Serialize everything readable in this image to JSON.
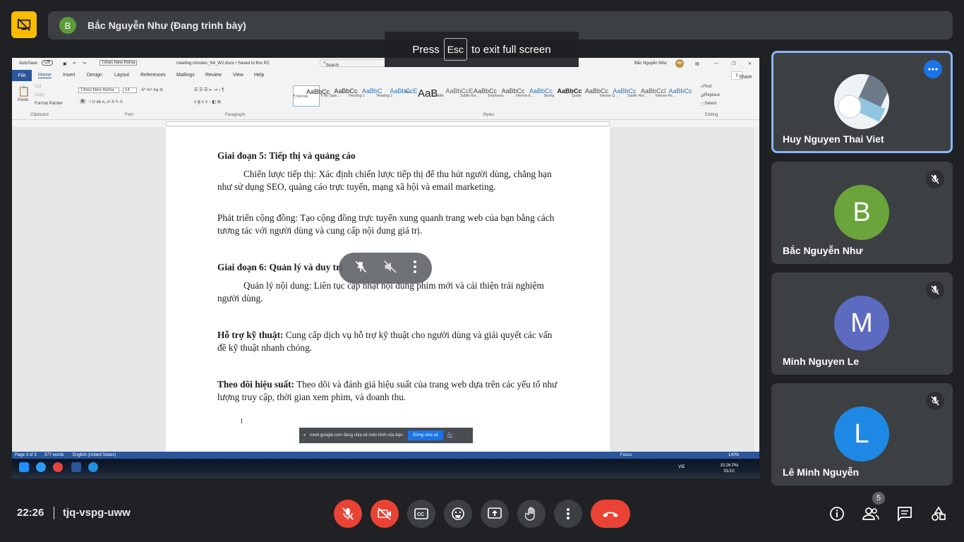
{
  "presenter": {
    "initial": "B",
    "label": "Bắc Nguyễn Như (Đang trình bày)"
  },
  "fullscreen_toast": {
    "press": "Press",
    "key": "Esc",
    "rest": "to exit full screen"
  },
  "word": {
    "autosave": "AutoSave",
    "autosave_state": "Off",
    "title": "meeting minutes_N4_W2.docx • Saved to this PC",
    "search": "Search",
    "user": "Bắc Nguyễn Như",
    "user_initials": "BN",
    "tabs": [
      "File",
      "Home",
      "Insert",
      "Design",
      "Layout",
      "References",
      "Mailings",
      "Review",
      "View",
      "Help"
    ],
    "share": "Share",
    "clipboard": {
      "paste": "Paste",
      "cut": "Cut",
      "copy": "Copy",
      "format_painter": "Format Painter",
      "group": "Clipboard"
    },
    "font": {
      "name": "Times New Roma",
      "size": "14",
      "group": "Font"
    },
    "paragraph_group": "Paragraph",
    "styles_group": "Styles",
    "editing": {
      "find": "Find",
      "replace": "Replace",
      "select": "Select",
      "group": "Editing"
    },
    "styles": [
      {
        "sample": "AaBbCc",
        "name": "¶ Normal"
      },
      {
        "sample": "AaBbCc",
        "name": "¶ No Spac..."
      },
      {
        "sample": "AaBbC",
        "name": "Heading 1"
      },
      {
        "sample": "AaBbCcE",
        "name": "Heading 2"
      },
      {
        "sample": "AaB",
        "name": "Title"
      },
      {
        "sample": "AaBbCcE",
        "name": "Subtitle"
      },
      {
        "sample": "AaBbCc",
        "name": "Subtle Em..."
      },
      {
        "sample": "AaBbCc",
        "name": "Emphasis"
      },
      {
        "sample": "AaBbCc",
        "name": "Intense E..."
      },
      {
        "sample": "AaBbCc",
        "name": "Strong"
      },
      {
        "sample": "AaBbCc",
        "name": "Quote"
      },
      {
        "sample": "AaBbCc",
        "name": "Intense Q..."
      },
      {
        "sample": "AaBbCcI",
        "name": "Subtle Ref..."
      },
      {
        "sample": "AaBbCc",
        "name": "Intense Re..."
      }
    ],
    "document": {
      "h5": "Giai đoạn 5: Tiếp thị và quảng cáo",
      "p1": "Chiến lược tiếp thị: Xác định chiến lược tiếp thị để thu hút người dùng, chẳng hạn như sử dụng SEO, quảng cáo trực tuyến, mạng xã hội và email marketing.",
      "p2": "Phát triển cộng đồng: Tạo cộng đồng trực tuyến xung quanh trang web của bạn bằng cách tương tác với người dùng và cung cấp nội dung giá trị.",
      "h6": "Giai đoạn 6: Quản lý và duy trì",
      "p3": "Quản lý nội dung: Liên tục cập nhật nội dung phim mới và cải thiện trải nghiệm người dùng.",
      "p4_bold": "Hỗ trợ kỹ thuật:",
      "p4": " Cung cấp dịch vụ hỗ trợ kỹ thuật cho người dùng và giải quyết các vấn đề kỹ thuật nhanh chóng.",
      "p5_bold": "Theo dõi hiệu suất:",
      "p5": " Theo dõi và đánh giá hiệu suất của trang web dựa trên các yếu tố như lượng truy cập, thời gian xem phim, và doanh thu."
    },
    "status": {
      "page": "Page 3 of 3",
      "words": "577 words",
      "language": "English (United States)",
      "focus": "Focus",
      "zoom": "140%"
    },
    "taskbar": {
      "lang": "VIE",
      "time": "10:26 PM",
      "date": "01/10"
    }
  },
  "share_notice": {
    "text": "meet.google.com đang chia sẻ màn hình của bạn.",
    "stop": "Dừng chia sẻ",
    "hide": "Ẩn"
  },
  "participants": [
    {
      "name": "Huy Nguyen Thai Viet",
      "initial": "",
      "color": "#d9e6ef"
    },
    {
      "name": "Bắc Nguyễn Như",
      "initial": "B",
      "color": "#6aa43a"
    },
    {
      "name": "Minh Nguyen Le",
      "initial": "M",
      "color": "#5c6bc0"
    },
    {
      "name": "Lê Minh Nguyễn",
      "initial": "L",
      "color": "#1e88e5"
    }
  ],
  "bottom": {
    "time": "22:26",
    "meeting_code": "tjq-vspg-uww",
    "people_count": "5"
  },
  "colors": {
    "background": "#202124",
    "tile": "#3c4043",
    "danger": "#ea4335",
    "accent": "#1a73e8",
    "word_blue": "#2b579a",
    "present_badge": "#fbbc04"
  }
}
